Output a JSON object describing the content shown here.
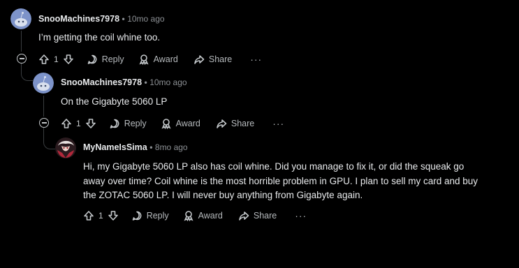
{
  "comments": [
    {
      "username": "SnooMachines7978",
      "separator": "•",
      "time": "10mo ago",
      "body": "I’m getting the coil whine too.",
      "votes": "1",
      "reply_label": "Reply",
      "award_label": "Award",
      "share_label": "Share",
      "more_label": "···"
    },
    {
      "username": "SnooMachines7978",
      "separator": "•",
      "time": "10mo ago",
      "body": "On the Gigabyte 5060 LP",
      "votes": "1",
      "reply_label": "Reply",
      "award_label": "Award",
      "share_label": "Share",
      "more_label": "···"
    },
    {
      "username": "MyNameIsSima",
      "separator": "•",
      "time": "8mo ago",
      "body_lines": [
        "Hi, my Gigabyte 5060 LP also has coil whine. Did you manage to fix it, or did the squeak go",
        "away over time? Coil whine is the most horrible problem in GPU. I plan to sell my card and buy",
        "the ZOTAC 5060 LP. I will never buy anything from Gigabyte again."
      ],
      "votes": "1",
      "reply_label": "Reply",
      "award_label": "Award",
      "share_label": "Share",
      "more_label": "···"
    }
  ],
  "colors": {
    "background": "#000000",
    "snoo_avatar_bg": "#7d93c9",
    "thread_line": "#3a3d40",
    "meta_text": "#8b8f93"
  },
  "icons": [
    "snoo-avatar-icon",
    "anime-avatar-icon",
    "collapse-icon",
    "upvote-icon",
    "downvote-icon",
    "reply-bubble-icon",
    "award-icon",
    "share-arrow-icon",
    "more-options-icon"
  ]
}
